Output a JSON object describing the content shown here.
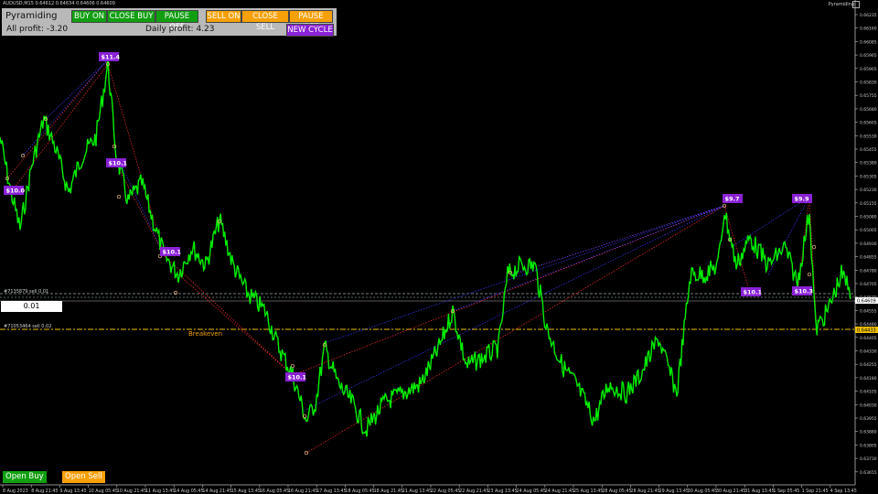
{
  "header": {
    "symbol_info": "AUDUSD,M15  0.64612 0.64634 0.64606 0.64609",
    "indicator_name": "Pyramiding"
  },
  "panel": {
    "title": "Pyramiding",
    "buy_on": "BUY ON",
    "close_buy": "CLOSE BUY",
    "pause_off_buy": "PAUSE OFF",
    "sell_on": "SELL ON",
    "close_sell": "CLOSE SELL",
    "pause_off_sell": "PAUSE OFF",
    "all_profit_label": "All profit: -3.20",
    "daily_profit_label": "Daily profit: 4.23",
    "new_cycle": "NEW CYCLE"
  },
  "lot_value": "0.01",
  "breakeven_label": "Breakeven",
  "order_labels": {
    "upper": "#7135879 sell 0.01",
    "lower": "#71053464 sell 0.02"
  },
  "bottom": {
    "open_buy": "Open Buy",
    "open_sell": "Open Sell"
  },
  "price_axis": {
    "ticks": [
      "0.66235",
      "0.66160",
      "0.66085",
      "0.65965",
      "0.65905",
      "0.65830",
      "0.65755",
      "0.65680",
      "0.65605",
      "0.65530",
      "0.65455",
      "0.65380",
      "0.65305",
      "0.65230",
      "0.65155",
      "0.65080",
      "0.65005",
      "0.64930",
      "0.64855",
      "0.64780",
      "0.64705",
      "0.64630",
      "0.64555",
      "0.64480",
      "0.64405",
      "0.64330",
      "0.64255",
      "0.64180",
      "0.64105",
      "0.64030",
      "0.63955",
      "0.63880",
      "0.63805",
      "0.63730",
      "0.63655"
    ],
    "current_price": "0.64609",
    "breakeven_price": "0.64433"
  },
  "time_axis": {
    "ticks": [
      "8 Aug 2023",
      "8 Aug 21:45",
      "9 Aug 13:45",
      "10 Aug 05:45",
      "10 Aug 21:45",
      "11 Aug 13:45",
      "14 Aug 05:45",
      "14 Aug 21:45",
      "15 Aug 13:45",
      "16 Aug 05:45",
      "16 Aug 21:45",
      "17 Aug 13:45",
      "18 Aug 05:45",
      "18 Aug 21:45",
      "21 Aug 13:45",
      "22 Aug 05:45",
      "22 Aug 21:45",
      "23 Aug 13:45",
      "24 Aug 05:45",
      "24 Aug 21:45",
      "25 Aug 13:45",
      "28 Aug 05:45",
      "28 Aug 21:45",
      "29 Aug 13:45",
      "30 Aug 05:45",
      "30 Aug 21:45",
      "31 Aug 13:45",
      "1 Sep 05:45",
      "1 Sep 21:45",
      "4 Sep 13:45"
    ]
  },
  "profit_tags": [
    "$11.4",
    "$10.0",
    "$10.1",
    "$10.1",
    "$10.1",
    "$9.7",
    "$9.9",
    "$10.1",
    "$10.3"
  ],
  "colors": {
    "candles": "#00ee00",
    "sell_lines": "#ff3030",
    "buy_lines": "#3a3aff",
    "tag_bg": "#8a21d6",
    "breakeven": "#f0c000"
  }
}
